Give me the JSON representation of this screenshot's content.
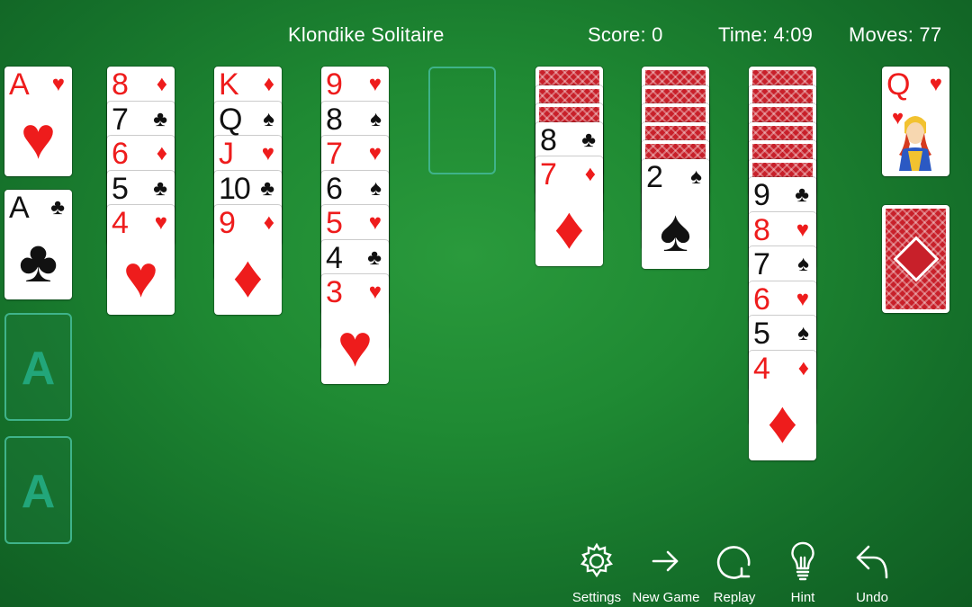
{
  "header": {
    "title": "Klondike Solitaire",
    "score": "Score: 0",
    "time": "Time: 4:09",
    "moves": "Moves: 77"
  },
  "foundations": [
    {
      "rank": "A",
      "suit": "♥",
      "color": "red"
    },
    {
      "rank": "A",
      "suit": "♣",
      "color": "black"
    },
    {
      "placeholder": "A"
    },
    {
      "placeholder": "A"
    }
  ],
  "tableau": {
    "col1": [
      {
        "rank": "8",
        "suit": "♦"
      },
      {
        "rank": "7",
        "suit": "♣"
      },
      {
        "rank": "6",
        "suit": "♦"
      },
      {
        "rank": "5",
        "suit": "♣"
      },
      {
        "rank": "4",
        "suit": "♥"
      }
    ],
    "col2": [
      {
        "rank": "K",
        "suit": "♦"
      },
      {
        "rank": "Q",
        "suit": "♠"
      },
      {
        "rank": "J",
        "suit": "♥"
      },
      {
        "rank": "10",
        "suit": "♣"
      },
      {
        "rank": "9",
        "suit": "♦"
      }
    ],
    "col3": [
      {
        "rank": "9",
        "suit": "♥"
      },
      {
        "rank": "8",
        "suit": "♠"
      },
      {
        "rank": "7",
        "suit": "♥"
      },
      {
        "rank": "6",
        "suit": "♠"
      },
      {
        "rank": "5",
        "suit": "♥"
      },
      {
        "rank": "4",
        "suit": "♣"
      },
      {
        "rank": "3",
        "suit": "♥"
      }
    ],
    "col5": [
      {
        "rank": "8",
        "suit": "♣"
      },
      {
        "rank": "7",
        "suit": "♦"
      }
    ],
    "col6": [
      {
        "rank": "2",
        "suit": "♠"
      }
    ],
    "col7": [
      {
        "rank": "9",
        "suit": "♣"
      },
      {
        "rank": "8",
        "suit": "♥"
      },
      {
        "rank": "7",
        "suit": "♠"
      },
      {
        "rank": "6",
        "suit": "♥"
      },
      {
        "rank": "5",
        "suit": "♠"
      },
      {
        "rank": "4",
        "suit": "♦"
      }
    ]
  },
  "waste": {
    "rank": "Q",
    "suit": "♥"
  },
  "toolbar": {
    "settings": "Settings",
    "new_game": "New Game",
    "replay": "Replay",
    "hint": "Hint",
    "undo": "Undo"
  },
  "colors": {
    "felt": "#1f8a33",
    "red_suit": "#ee1c1c",
    "black_suit": "#111111",
    "card_back": "#c8202a",
    "slot_outline": "#3fb38a"
  }
}
